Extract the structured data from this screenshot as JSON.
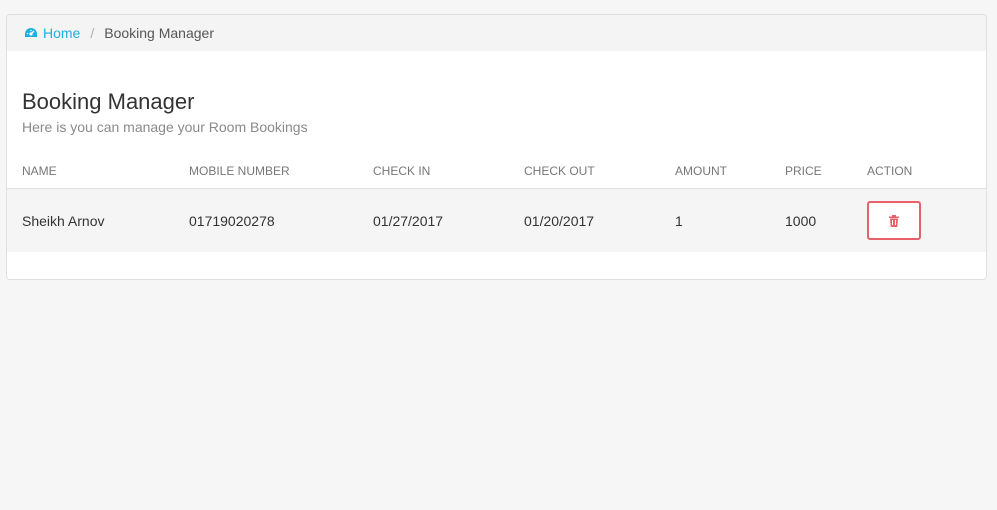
{
  "breadcrumb": {
    "home_icon": "dashboard-gauge-icon",
    "home_label": "Home",
    "separator": "/",
    "current": "Booking Manager"
  },
  "header": {
    "title": "Booking Manager",
    "subtitle": "Here is you can manage your Room Bookings"
  },
  "table": {
    "columns": [
      "NAME",
      "MOBILE NUMBER",
      "CHECK IN",
      "CHECK OUT",
      "AMOUNT",
      "PRICE",
      "ACTION"
    ],
    "rows": [
      {
        "name": "Sheikh Arnov",
        "mobile": "01719020278",
        "check_in": "01/27/2017",
        "check_out": "01/20/2017",
        "amount": "1",
        "price": "1000",
        "action_icon": "trash-icon"
      }
    ]
  },
  "colors": {
    "accent": "#1ab0e0",
    "danger": "#e8606a",
    "background": "#f6f6f6"
  }
}
